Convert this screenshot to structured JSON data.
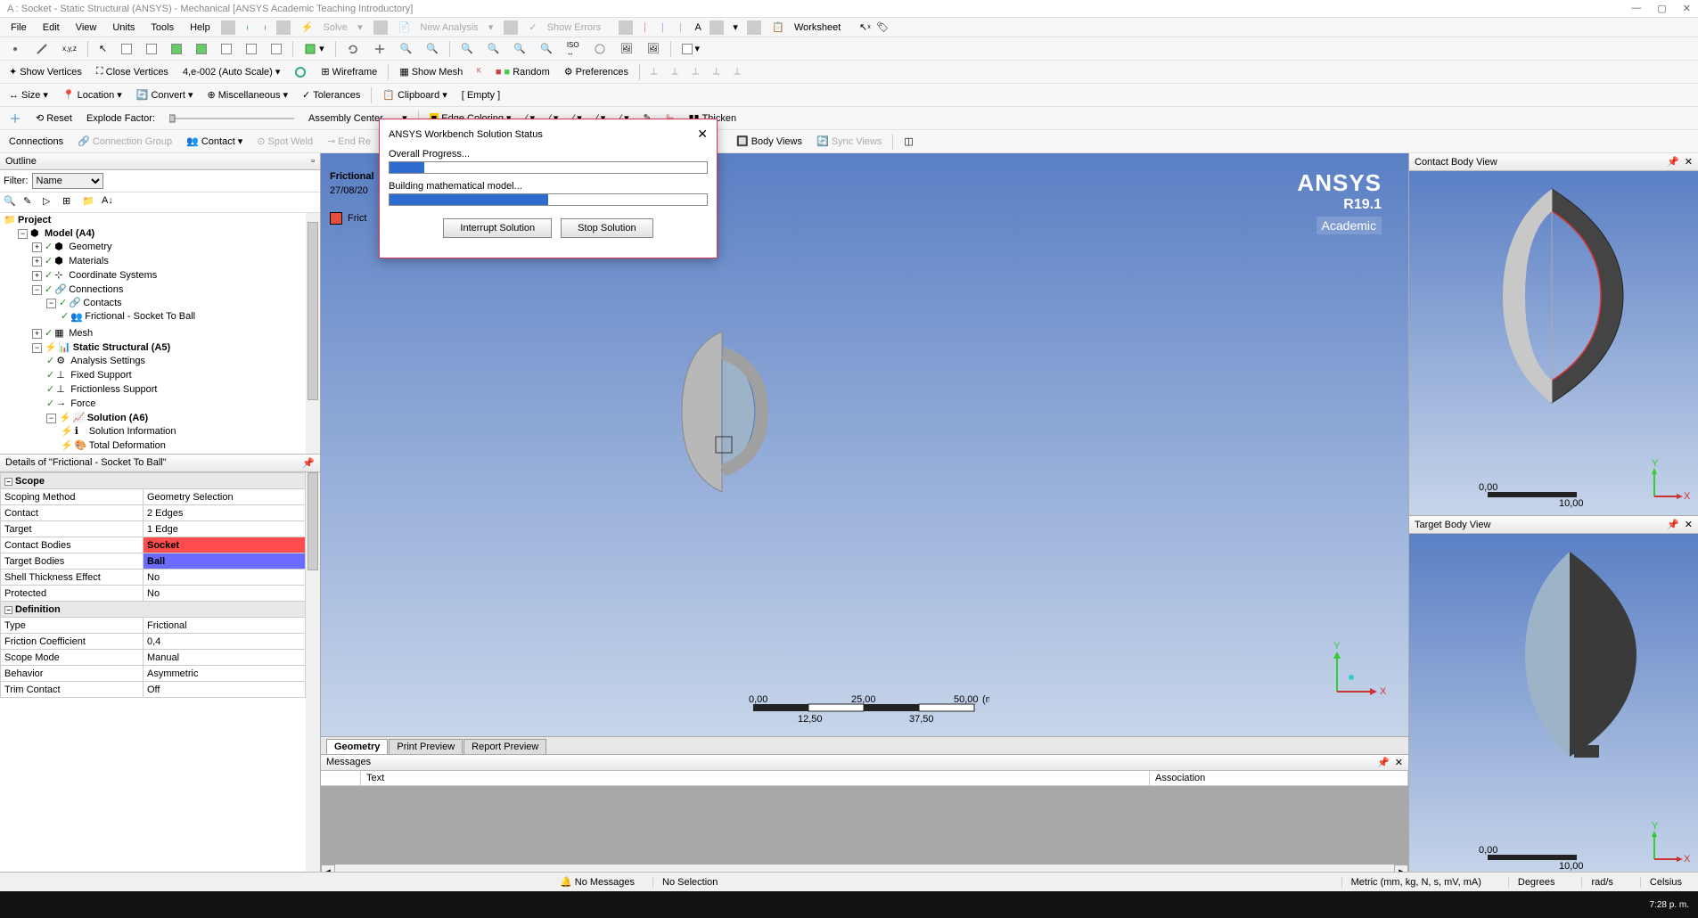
{
  "title": "A : Socket - Static Structural (ANSYS) - Mechanical [ANSYS Academic Teaching Introductory]",
  "menu": {
    "file": "File",
    "edit": "Edit",
    "view": "View",
    "units": "Units",
    "tools": "Tools",
    "help": "Help",
    "solve": "Solve",
    "new_analysis": "New Analysis",
    "show_errors": "Show Errors",
    "worksheet": "Worksheet"
  },
  "tb2": {
    "show_vertices": "Show Vertices",
    "close_vertices": "Close Vertices",
    "scale": "4,e-002 (Auto Scale)",
    "wireframe": "Wireframe",
    "show_mesh": "Show Mesh",
    "random": "Random",
    "preferences": "Preferences"
  },
  "tb3": {
    "size": "Size",
    "location": "Location",
    "convert": "Convert",
    "misc": "Miscellaneous",
    "tolerances": "Tolerances",
    "clipboard": "Clipboard",
    "empty": "[ Empty ]"
  },
  "tb4": {
    "reset": "Reset",
    "explode": "Explode Factor:",
    "assembly": "Assembly Center",
    "edge": "Edge Coloring",
    "thicken": "Thicken"
  },
  "tb5": {
    "connections": "Connections",
    "conn_group": "Connection Group",
    "contact": "Contact",
    "spot_weld": "Spot Weld",
    "end_re": "End Re",
    "body_views": "Body Views",
    "sync_views": "Sync Views"
  },
  "outline": {
    "title": "Outline",
    "filter_label": "Filter:",
    "filter_value": "Name"
  },
  "tree": {
    "project": "Project",
    "model": "Model (A4)",
    "geometry": "Geometry",
    "materials": "Materials",
    "coord": "Coordinate Systems",
    "connections": "Connections",
    "contacts": "Contacts",
    "friction_item": "Frictional - Socket To Ball",
    "mesh": "Mesh",
    "static": "Static Structural (A5)",
    "analysis": "Analysis Settings",
    "fixed": "Fixed Support",
    "frictionless": "Frictionless Support",
    "force": "Force",
    "solution": "Solution (A6)",
    "sol_info": "Solution Information",
    "total_def": "Total Deformation"
  },
  "details": {
    "title": "Details of \"Frictional - Socket To Ball\"",
    "scope": "Scope",
    "scoping_method": "Scoping Method",
    "scoping_method_v": "Geometry Selection",
    "contact": "Contact",
    "contact_v": "2 Edges",
    "target": "Target",
    "target_v": "1 Edge",
    "contact_bodies": "Contact Bodies",
    "contact_bodies_v": "Socket",
    "target_bodies": "Target Bodies",
    "target_bodies_v": "Ball",
    "shell": "Shell Thickness Effect",
    "shell_v": "No",
    "protected": "Protected",
    "protected_v": "No",
    "definition": "Definition",
    "type": "Type",
    "type_v": "Frictional",
    "fc": "Friction Coefficient",
    "fc_v": "0,4",
    "scope_mode": "Scope Mode",
    "scope_mode_v": "Manual",
    "behavior": "Behavior",
    "behavior_v": "Asymmetric",
    "trim": "Trim Contact",
    "trim_v": "Off"
  },
  "graphics": {
    "heading": "Frictional",
    "date": "27/08/20",
    "legend": "Frict",
    "brand": "ANSYS",
    "ver": "R19.1",
    "acad": "Academic",
    "y": "Y",
    "x": "X"
  },
  "scale": {
    "s0": "0,00",
    "s1": "12,50",
    "s2": "25,00",
    "s3": "37,50",
    "s4": "50,00",
    "unit": "(mm)"
  },
  "rscale": {
    "s0": "0,00",
    "s1": "10,00"
  },
  "tabs": {
    "geo": "Geometry",
    "print": "Print Preview",
    "report": "Report Preview"
  },
  "messages": {
    "title": "Messages",
    "text": "Text",
    "assoc": "Association"
  },
  "right": {
    "contact": "Contact Body View",
    "target": "Target Body View"
  },
  "dialog": {
    "title": "ANSYS Workbench Solution Status",
    "overall": "Overall Progress...",
    "building": "Building mathematical model...",
    "interrupt": "Interrupt Solution",
    "stop": "Stop Solution"
  },
  "status": {
    "no_msg": "No Messages",
    "no_sel": "No Selection",
    "units": "Metric (mm, kg, N, s, mV, mA)",
    "deg": "Degrees",
    "rads": "rad/s",
    "cel": "Celsius"
  },
  "clock": "7:28 p. m."
}
